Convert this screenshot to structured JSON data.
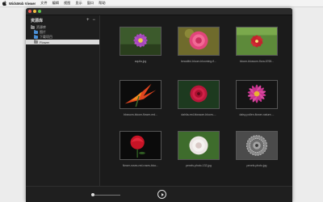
{
  "menubar": {
    "app_name": "WidsMob Viewer",
    "items": [
      "文件",
      "编辑",
      "视图",
      "显示",
      "窗口",
      "帮助"
    ]
  },
  "sidebar": {
    "title": "资源库",
    "add_label": "+",
    "remove_label": "−",
    "tree": [
      {
        "label": "资源库"
      },
      {
        "label": "图片"
      },
      {
        "label": "下载项目"
      },
      {
        "label": "Flower"
      }
    ]
  },
  "gallery": {
    "items": [
      {
        "caption": "aquila.jpg"
      },
      {
        "caption": "beautiful-bloom-blooming-fl..."
      },
      {
        "caption": "bloom-blossom-flora-6765..."
      },
      {
        "caption": "blossom-bloom-flower-red..."
      },
      {
        "caption": "dahlia-red-blossom-bloom-..."
      },
      {
        "caption": "daisy-pollen-flower-nature-..."
      },
      {
        "caption": "flower-roses-red-roses-bloo..."
      },
      {
        "caption": "pexels-photo-132.jpg"
      },
      {
        "caption": "pexels-photo.jpg"
      }
    ]
  },
  "colors": {
    "window_bg": "#1a1a1a",
    "sidebar_bg": "#1e1e1e",
    "folder_blue": "#4a8fd6"
  }
}
